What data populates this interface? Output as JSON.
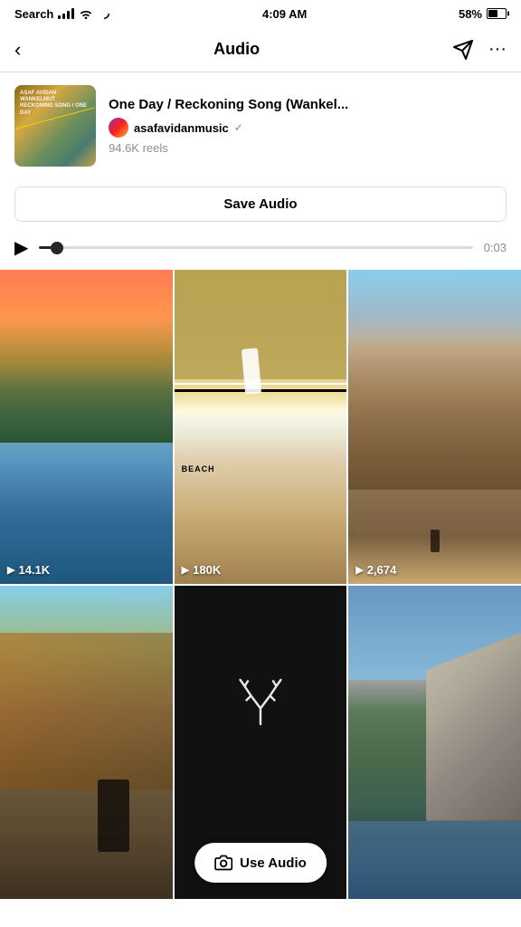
{
  "status_bar": {
    "carrier": "Search",
    "time": "4:09 AM",
    "battery": "58%"
  },
  "nav": {
    "back_label": "‹",
    "title": "Audio",
    "send_icon": "send",
    "more_icon": "···"
  },
  "audio": {
    "title": "One Day / Reckoning Song (Wankel...",
    "artist": "asafavidanmusic",
    "reels_count": "94.6K reels",
    "save_button": "Save Audio",
    "time_display": "0:03"
  },
  "player": {
    "progress_percent": 4
  },
  "reels": [
    {
      "id": 1,
      "views": "14.1K",
      "bg_class": "reel-bg-1"
    },
    {
      "id": 2,
      "views": "180K",
      "bg_class": "reel-bg-2"
    },
    {
      "id": 3,
      "views": "2,674",
      "bg_class": "reel-bg-3"
    },
    {
      "id": 4,
      "views": "",
      "bg_class": "reel-bg-4"
    },
    {
      "id": 5,
      "views": "",
      "bg_class": "reel-bg-5"
    },
    {
      "id": 6,
      "views": "",
      "bg_class": "reel-bg-6"
    }
  ],
  "use_audio_button": "Use Audio",
  "colors": {
    "accent": "#3897f0",
    "border": "#dbdbdb",
    "text_secondary": "#8e8e8e"
  }
}
